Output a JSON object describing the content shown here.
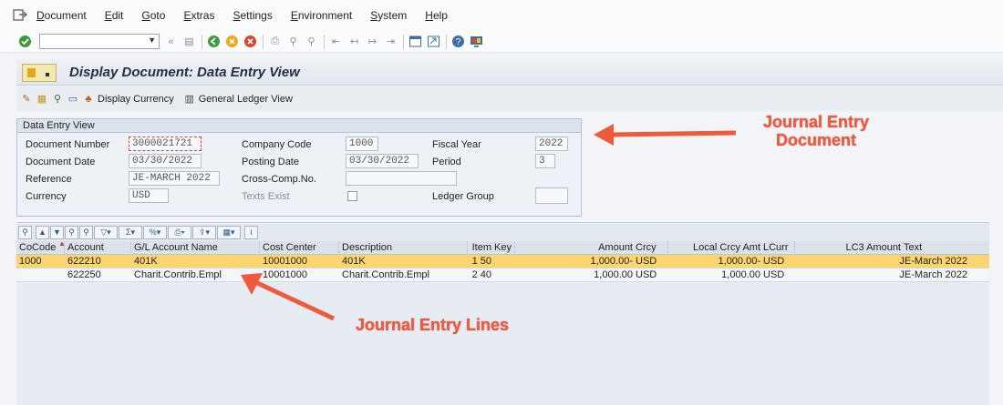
{
  "menubar": {
    "items": [
      {
        "label": "Document",
        "u": "D",
        "rest": "ocument"
      },
      {
        "label": "Edit",
        "u": "E",
        "rest": "dit"
      },
      {
        "label": "Goto",
        "u": "G",
        "rest": "oto"
      },
      {
        "label": "Extras",
        "u": "E",
        "rest": "xtras"
      },
      {
        "label": "Settings",
        "u": "S",
        "rest": "ettings"
      },
      {
        "label": "Environment",
        "u": "E",
        "rest": "nvironment"
      },
      {
        "label": "System",
        "u": "S",
        "rest": "ystem"
      },
      {
        "label": "Help",
        "u": "H",
        "rest": "elp"
      }
    ]
  },
  "title": "Display Document: Data Entry View",
  "appbar": {
    "display_currency": "Display Currency",
    "general_ledger_view": "General Ledger View"
  },
  "entry_panel": {
    "title": "Data Entry View",
    "document_number_label": "Document Number",
    "document_number": "3000021721",
    "company_code_label": "Company Code",
    "company_code": "1000",
    "fiscal_year_label": "Fiscal Year",
    "fiscal_year": "2022",
    "document_date_label": "Document Date",
    "document_date": "03/30/2022",
    "posting_date_label": "Posting Date",
    "posting_date": "03/30/2022",
    "period_label": "Period",
    "period": "3",
    "reference_label": "Reference",
    "reference": "JE-MARCH 2022",
    "cross_comp_label": "Cross-Comp.No.",
    "cross_comp": "",
    "currency_label": "Currency",
    "currency": "USD",
    "texts_exist_label": "Texts Exist",
    "ledger_group_label": "Ledger Group",
    "ledger_group": ""
  },
  "annotations": {
    "document_line1": "Journal Entry",
    "document_line2": "Document",
    "lines": "Journal Entry Lines"
  },
  "grid": {
    "headers": {
      "cocode": "CoCode",
      "account": "Account",
      "gl_name": "G/L Account Name",
      "cost_center": "Cost Center",
      "description": "Description",
      "item_key": "Item Key",
      "amount": "Amount",
      "crcy": "Crcy",
      "local_amt": "Local Crcy Amt",
      "lcurr": "LCurr",
      "lc3": "LC3 Amount",
      "text": "Text"
    },
    "rows": [
      {
        "cocode": "1000",
        "account": "622210",
        "gl_name": "401K",
        "cost_center": "10001000",
        "description": "401K",
        "item_key": "1 50",
        "amount": "1,000.00-",
        "crcy": "USD",
        "local_amt": "1,000.00-",
        "lcurr": "USD",
        "lc3": "",
        "text": "JE-March 2022"
      },
      {
        "cocode": "",
        "account": "622250",
        "gl_name": "Charit.Contrib.Empl",
        "cost_center": "10001000",
        "description": "Charit.Contrib.Empl",
        "item_key": "2 40",
        "amount": "1,000.00",
        "crcy": "USD",
        "local_amt": "1,000.00",
        "lcurr": "USD",
        "lc3": "",
        "text": "JE-March 2022"
      }
    ]
  }
}
